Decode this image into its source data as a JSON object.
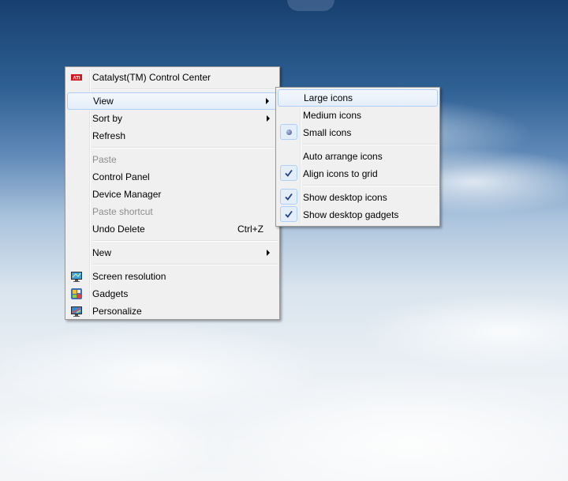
{
  "context_menu": {
    "items": [
      {
        "label": "Catalyst(TM) Control Center",
        "icon": "ati-logo-icon"
      },
      {
        "label": "View",
        "has_submenu": true,
        "highlighted": true
      },
      {
        "label": "Sort by",
        "has_submenu": true
      },
      {
        "label": "Refresh"
      },
      {
        "label": "Paste",
        "disabled": true
      },
      {
        "label": "Control Panel"
      },
      {
        "label": "Device Manager"
      },
      {
        "label": "Paste shortcut",
        "disabled": true
      },
      {
        "label": "Undo Delete",
        "shortcut": "Ctrl+Z"
      },
      {
        "label": "New",
        "has_submenu": true
      },
      {
        "label": "Screen resolution",
        "icon": "screen-resolution-icon"
      },
      {
        "label": "Gadgets",
        "icon": "gadgets-icon"
      },
      {
        "label": "Personalize",
        "icon": "personalize-icon"
      }
    ]
  },
  "view_submenu": {
    "items": [
      {
        "label": "Large icons",
        "highlighted": true
      },
      {
        "label": "Medium icons"
      },
      {
        "label": "Small icons",
        "mark": "radio-bullet-icon"
      },
      {
        "label": "Auto arrange icons"
      },
      {
        "label": "Align icons to grid",
        "mark": "checkmark-icon"
      },
      {
        "label": "Show desktop icons",
        "mark": "checkmark-icon"
      },
      {
        "label": "Show desktop gadgets",
        "mark": "checkmark-icon"
      }
    ]
  },
  "colors": {
    "menu_background": "#f0f0f0",
    "menu_border": "#979797",
    "highlight_border": "#aecff7",
    "disabled_text": "#8d8d8d"
  }
}
